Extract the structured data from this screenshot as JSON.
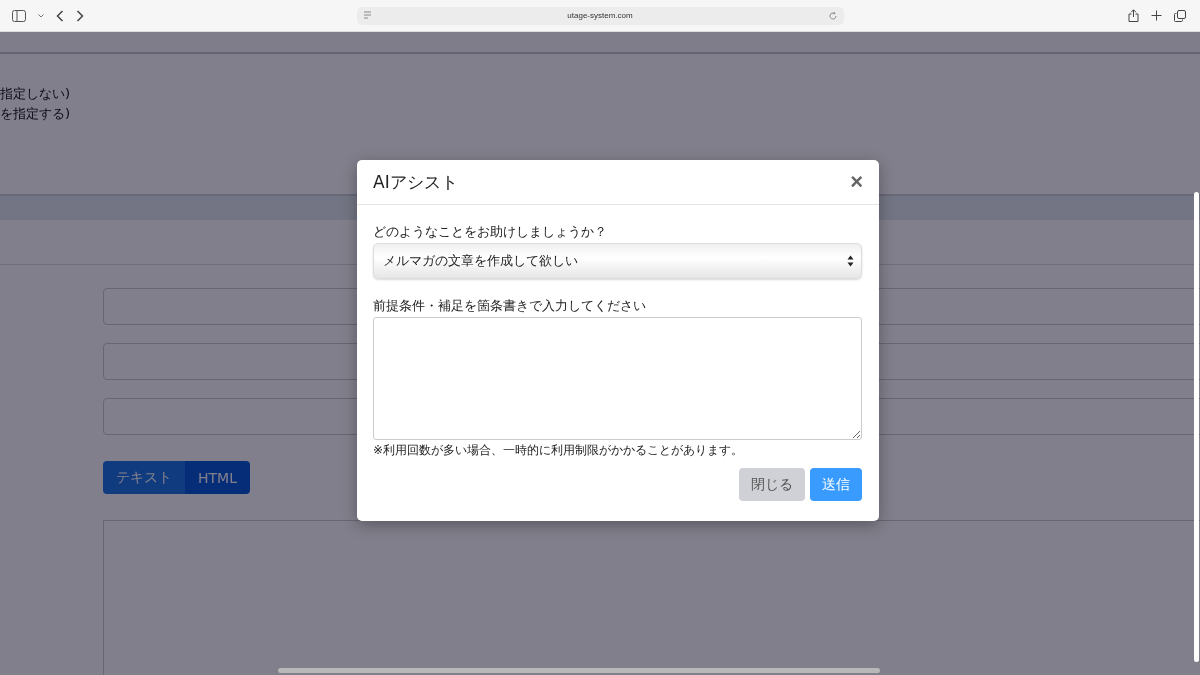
{
  "browser": {
    "url": "utage-system.com"
  },
  "page": {
    "option_lines": [
      "指定しない)",
      "を指定する)"
    ],
    "editor_modes": [
      {
        "label": "テキスト",
        "selected": false
      },
      {
        "label": "HTML",
        "selected": true
      }
    ]
  },
  "dialog": {
    "title": "AIアシスト",
    "close": "×",
    "question_label": "どのようなことをお助けしましょうか？",
    "request_select": {
      "value": "メルマガの文章を作成して欲しい"
    },
    "conditions_label": "前提条件・補足を箇条書きで入力してください",
    "note": "※利用回数が多い場合、一時的に利用制限がかかることがあります。",
    "buttons": [
      {
        "label": "閉じる",
        "kind": "secondary"
      },
      {
        "label": "送信",
        "kind": "primary"
      }
    ]
  }
}
